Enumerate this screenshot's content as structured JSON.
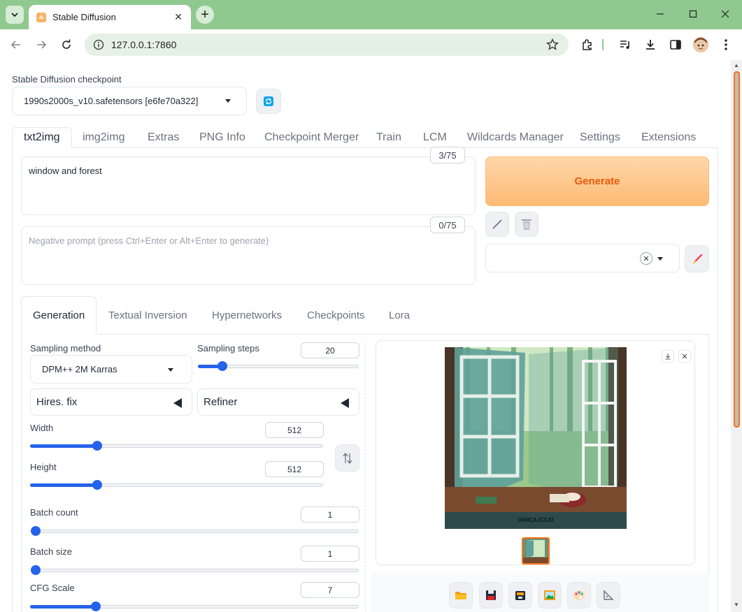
{
  "browser": {
    "tab_title": "Stable Diffusion",
    "url": "127.0.0.1:7860"
  },
  "checkpoint": {
    "label": "Stable Diffusion checkpoint",
    "value": "1990s2000s_v10.safetensors [e6fe70a322]"
  },
  "main_tabs": [
    "txt2img",
    "img2img",
    "Extras",
    "PNG Info",
    "Checkpoint Merger",
    "Train",
    "LCM",
    "Wildcards Manager",
    "Settings",
    "Extensions"
  ],
  "prompt": {
    "value": "window and forest",
    "token_count": "3/75"
  },
  "negative_prompt": {
    "placeholder": "Negative prompt (press Ctrl+Enter or Alt+Enter to generate)",
    "token_count": "0/75"
  },
  "generate_label": "Generate",
  "sub_tabs": [
    "Generation",
    "Textual Inversion",
    "Hypernetworks",
    "Checkpoints",
    "Lora"
  ],
  "generation": {
    "sampling_method_label": "Sampling method",
    "sampling_method_value": "DPM++ 2M Karras",
    "sampling_steps_label": "Sampling steps",
    "sampling_steps_value": "20",
    "hires_fix_label": "Hires. fix",
    "refiner_label": "Refiner",
    "width_label": "Width",
    "width_value": "512",
    "height_label": "Height",
    "height_value": "512",
    "batch_count_label": "Batch count",
    "batch_count_value": "1",
    "batch_size_label": "Batch size",
    "batch_size_value": "1",
    "cfg_label": "CFG Scale",
    "cfg_value": "7"
  },
  "sliders": {
    "sampling_steps": 0.15,
    "width": 0.23,
    "height": 0.23,
    "batch_count": 0.0,
    "batch_size": 0.0,
    "cfg": 0.2
  },
  "output_image_caption": "IANICA ICCAI",
  "colors": {
    "accent": "#2563eb",
    "generate_text": "#ea580c",
    "browser_frame": "#8fc98f"
  }
}
